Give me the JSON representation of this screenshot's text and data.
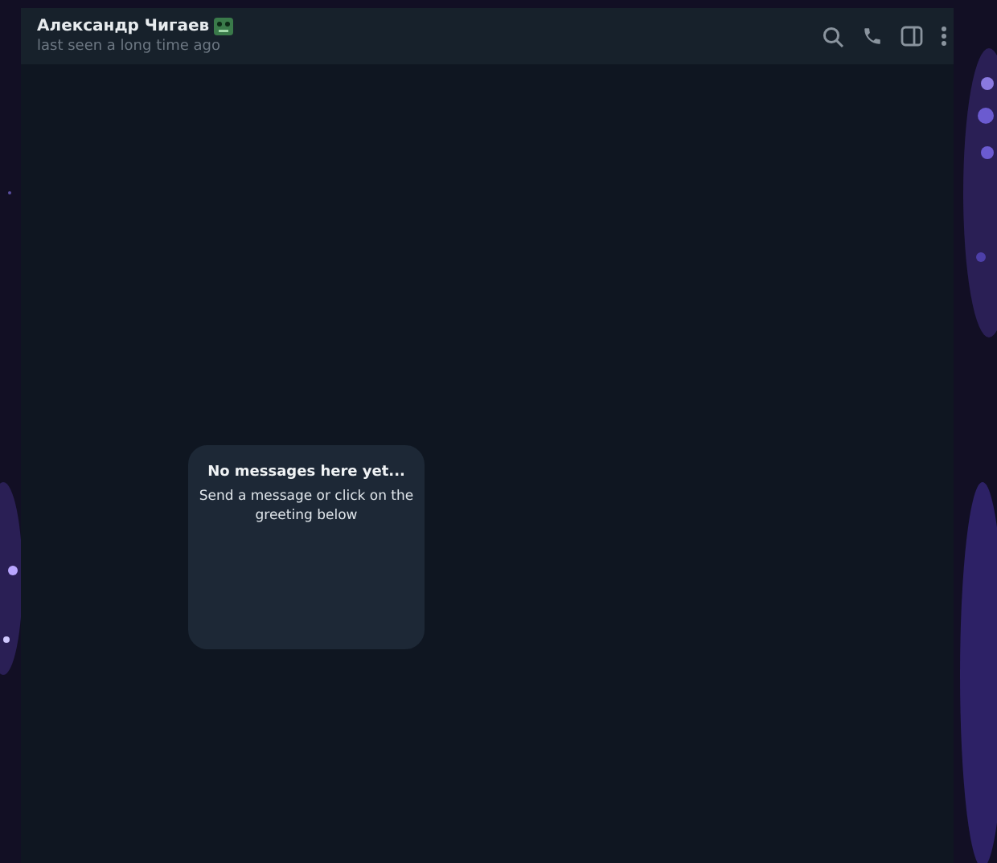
{
  "header": {
    "name": "Александр Чигаев",
    "status": "last seen a long time ago"
  },
  "empty_state": {
    "title": "No messages here yet...",
    "text": "Send a message or click on the greeting below"
  }
}
